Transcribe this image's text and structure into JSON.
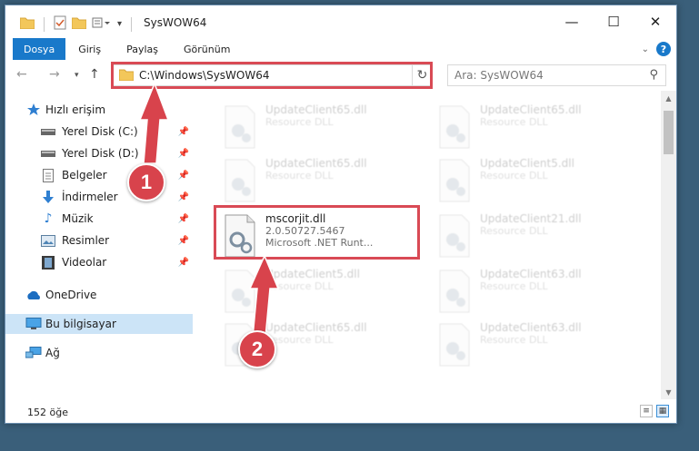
{
  "window": {
    "title": "SysWOW64"
  },
  "ribbon": {
    "tabs": [
      "Dosya",
      "Giriş",
      "Paylaş",
      "Görünüm"
    ],
    "help_label": "?"
  },
  "address": {
    "path": "C:\\Windows\\SysWOW64"
  },
  "search": {
    "placeholder": "Ara: SysWOW64"
  },
  "sidebar": {
    "items": [
      {
        "label": "Hızlı erişim",
        "icon": "star-icon",
        "pinned": false
      },
      {
        "label": "Yerel Disk (C:)",
        "icon": "drive-icon",
        "pinned": true
      },
      {
        "label": "Yerel Disk (D:)",
        "icon": "drive-icon",
        "pinned": true
      },
      {
        "label": "Belgeler",
        "icon": "documents-icon",
        "pinned": true
      },
      {
        "label": "İndirmeler",
        "icon": "download-icon",
        "pinned": true
      },
      {
        "label": "Müzik",
        "icon": "music-icon",
        "pinned": true
      },
      {
        "label": "Resimler",
        "icon": "pictures-icon",
        "pinned": true
      },
      {
        "label": "Videolar",
        "icon": "videos-icon",
        "pinned": true
      },
      {
        "label": "OneDrive",
        "icon": "cloud-icon",
        "pinned": false
      },
      {
        "label": "Bu bilgisayar",
        "icon": "computer-icon",
        "pinned": false,
        "selected": true
      },
      {
        "label": "Ağ",
        "icon": "network-icon",
        "pinned": false
      }
    ]
  },
  "files": {
    "highlighted": {
      "name": "mscorjit.dll",
      "version": "2.0.50727.5467",
      "description": "Microsoft .NET Runt..."
    },
    "faded": [
      {
        "name": "UpdateClient65.dll",
        "desc": "Resource DLL"
      },
      {
        "name": "UpdateClient65.dll",
        "desc": "Resource DLL"
      },
      {
        "name": "UpdateClient65.dll",
        "desc": "Resource DLL"
      },
      {
        "name": "UpdateClient5.dll",
        "desc": "Resource DLL"
      },
      {
        "name": "UpdateClient21.dll",
        "desc": "Resource DLL"
      },
      {
        "name": "UpdateClient5.dll",
        "desc": "Resource DLL"
      },
      {
        "name": "UpdateClient63.dll",
        "desc": "Resource DLL"
      },
      {
        "name": "UpdateClient65.dll",
        "desc": "Resource DLL"
      },
      {
        "name": "UpdateClient63.dll",
        "desc": "Resource DLL"
      }
    ]
  },
  "status": {
    "count": "152 öğe"
  },
  "annotations": {
    "step1": "1",
    "step2": "2"
  },
  "colors": {
    "accent": "#1979ca",
    "annotation": "#d94a55",
    "selected": "#cce4f7"
  }
}
